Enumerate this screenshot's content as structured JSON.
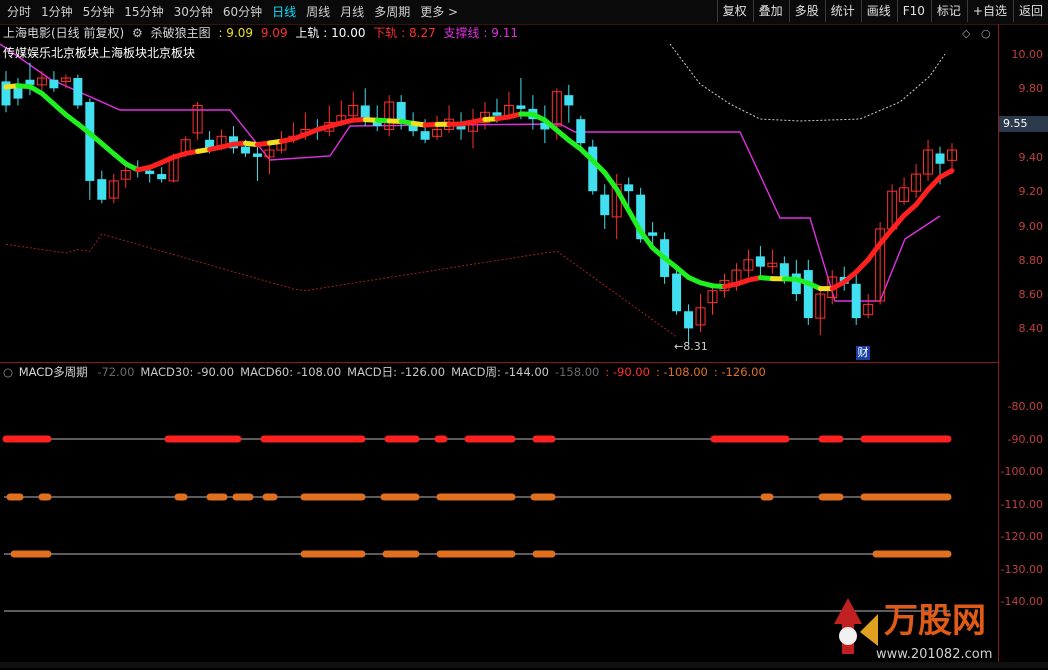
{
  "toolbar": {
    "periods": [
      "分时",
      "1分钟",
      "5分钟",
      "15分钟",
      "30分钟",
      "60分钟",
      "日线",
      "周线",
      "月线",
      "多周期",
      "更多 >"
    ],
    "active_period": "日线",
    "right_buttons": [
      "复权",
      "叠加",
      "多股",
      "统计",
      "画线",
      "F10",
      "标记",
      "+自选",
      "返回"
    ]
  },
  "header": {
    "title": "上海电影(日线 前复权)",
    "indicator_name": "杀破狼主图",
    "v1": ": 9.09",
    "v2": "9.09",
    "upper_label": "上轨",
    "upper_value": ": 10.00",
    "lower_label": "下轨",
    "lower_value": ": 8.27",
    "support_label": "支撑线",
    "support_value": ": 9.11"
  },
  "sector_text": "传媒娱乐北京板块上海板块北京板块",
  "price_axis": [
    "10.00",
    "9.80",
    "9.60",
    "9.40",
    "9.20",
    "9.00",
    "8.80",
    "8.60",
    "8.40"
  ],
  "current_price": "9.55",
  "low_marker": "8.31",
  "cai_badge": "财",
  "macd": {
    "title": "MACD多周期",
    "items": [
      {
        "text": "-72.00",
        "color": "#6a6a6a"
      },
      {
        "text": "MACD30: -90.00",
        "color": "#c8c8c8"
      },
      {
        "text": "MACD60: -108.00",
        "color": "#c8c8c8"
      },
      {
        "text": "MACD日: -126.00",
        "color": "#c8c8c8"
      },
      {
        "text": "MACD周: -144.00",
        "color": "#c8c8c8"
      },
      {
        "text": "-158.00",
        "color": "#6a6a6a"
      },
      {
        "text": ": -90.00",
        "color": "#ff3030"
      },
      {
        "text": ": -108.00",
        "color": "#e07020"
      },
      {
        "text": ": -126.00",
        "color": "#e07020"
      }
    ],
    "axis": [
      "-80.00",
      "-90.00",
      "-100.00",
      "-110.00",
      "-120.00",
      "-130.00",
      "-140.00"
    ]
  },
  "watermark": {
    "brand": "万股网",
    "url": "www.201082.com"
  },
  "colors": {
    "up": "#ff3030",
    "down": "#40e0f0",
    "magenta": "#e030e0",
    "green": "#20f020",
    "red": "#ff2020",
    "orange": "#e07020"
  }
}
